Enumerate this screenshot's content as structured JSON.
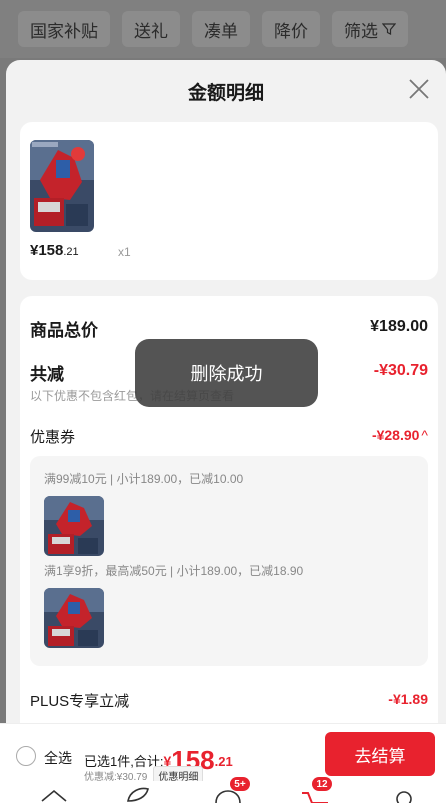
{
  "filters": [
    "国家补贴",
    "送礼",
    "凑单",
    "降价",
    "筛选"
  ],
  "sheet": {
    "title": "金额明细",
    "product": {
      "price_main": "¥158",
      "price_dec": ".21",
      "quantity": "x1"
    },
    "total_label": "商品总价",
    "total_value": "¥189.00",
    "reduce_label": "共减",
    "reduce_value": "-¥30.79",
    "reduce_note": "以下优惠不包含红包，请在结算页查看",
    "coupon_label": "优惠券",
    "coupon_value": "-¥28.90",
    "coupon_chevron": "^",
    "coupon_rule_1": "满99减10元 | 小计189.00，已减10.00",
    "coupon_rule_2": "满1享9折，最高减50元 | 小计189.00，已减18.90",
    "plus_label": "PLUS专享立减",
    "plus_value": "-¥1.89"
  },
  "toast": "删除成功",
  "checkout": {
    "select_all": "全选",
    "summary_prefix": "已选1件,合计:",
    "currency": "¥",
    "amount_main": "158",
    "amount_dec": ".21",
    "discount_note": "优惠减:¥30.79",
    "detail_chip": "优惠明细",
    "button": "去结算"
  },
  "tabbar": {
    "badge_messages": "5+",
    "badge_cart": "12"
  },
  "colors": {
    "accent": "#e8222e"
  }
}
